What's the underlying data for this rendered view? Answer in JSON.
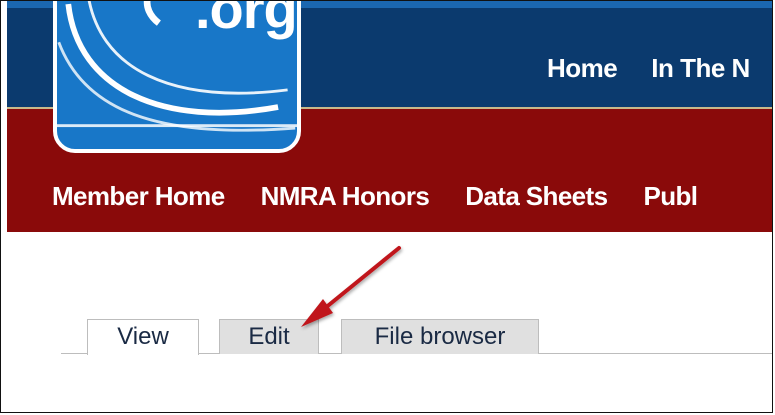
{
  "colors": {
    "navy": "#0b3a6e",
    "brand_red": "#8a0a0a",
    "logo_blue": "#1877c8",
    "tab_inactive": "#e0e0e0",
    "arrow_red": "#c0161b"
  },
  "logo": {
    "text": ".org",
    "icon": "organization-logo"
  },
  "main_nav": {
    "items": [
      {
        "label": "Home"
      },
      {
        "label": "In The N"
      }
    ]
  },
  "sub_nav": {
    "items": [
      {
        "label": "Member Home"
      },
      {
        "label": "NMRA Honors"
      },
      {
        "label": "Data Sheets"
      },
      {
        "label": "Publ"
      }
    ]
  },
  "tabs": [
    {
      "label": "View",
      "active": true
    },
    {
      "label": "Edit",
      "active": false
    },
    {
      "label": "File browser",
      "active": false
    }
  ],
  "annotation": {
    "icon": "arrow-icon",
    "target": "Edit"
  }
}
